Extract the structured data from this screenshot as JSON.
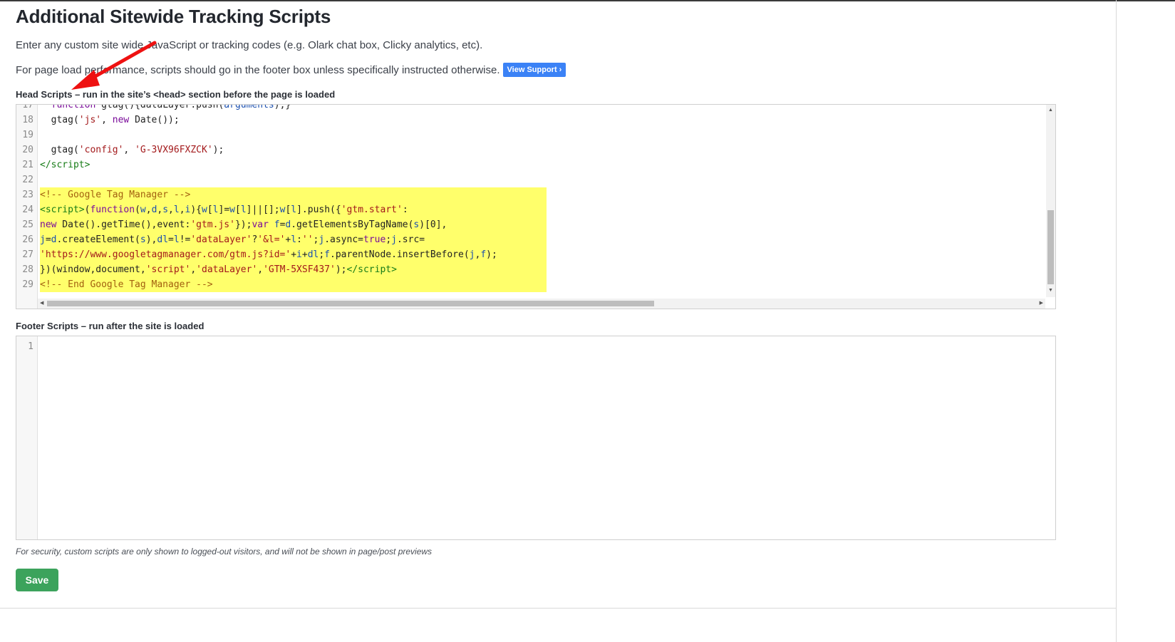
{
  "page": {
    "title": "Additional Sitewide Tracking Scripts",
    "intro": "Enter any custom site wide JavaScript or tracking codes (e.g. Olark chat box, Clicky analytics, etc).",
    "performance_note": "For page load performance, scripts should go in the footer box unless specifically instructed otherwise.",
    "support_label": "View Support ›"
  },
  "head_scripts": {
    "label": "Head Scripts – run in the site’s <head> section before the page is loaded",
    "line_numbers": [
      "17",
      "18",
      "19",
      "20",
      "21",
      "22",
      "23",
      "24",
      "25",
      "26",
      "27",
      "28",
      "29"
    ],
    "highlighted_lines": [
      "23",
      "24",
      "25",
      "26",
      "27",
      "28",
      "29"
    ]
  },
  "footer_scripts": {
    "label": "Footer Scripts – run after the site is loaded",
    "line_numbers": [
      "1"
    ],
    "content": ""
  },
  "security_note": "For security, custom scripts are only shown to logged-out visitors, and will not be shown in page/post previews",
  "save_label": "Save",
  "colors": {
    "support_button": "#3b82f6",
    "save_button": "#3ca35c",
    "highlight": "#ffff6b",
    "annotation_arrow": "#ee1111"
  }
}
